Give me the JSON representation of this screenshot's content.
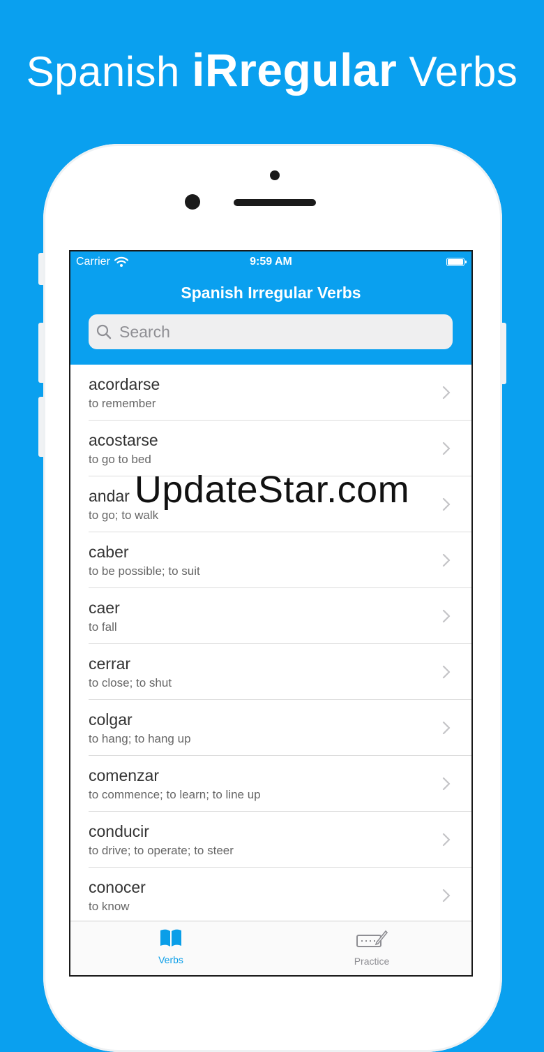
{
  "headline": {
    "part1": "Spanish ",
    "part2": "iRregular",
    "part3": " Verbs"
  },
  "status_bar": {
    "carrier": "Carrier",
    "time": "9:59 AM"
  },
  "nav": {
    "title": "Spanish Irregular Verbs"
  },
  "search": {
    "placeholder": "Search"
  },
  "verbs": [
    {
      "verb": "acordarse",
      "meaning": "to remember"
    },
    {
      "verb": "acostarse",
      "meaning": "to go to bed"
    },
    {
      "verb": "andar",
      "meaning": "to go; to walk"
    },
    {
      "verb": "caber",
      "meaning": "to be possible; to suit"
    },
    {
      "verb": "caer",
      "meaning": "to fall"
    },
    {
      "verb": "cerrar",
      "meaning": "to close; to shut"
    },
    {
      "verb": "colgar",
      "meaning": "to hang; to hang up"
    },
    {
      "verb": "comenzar",
      "meaning": "to commence; to learn; to line up"
    },
    {
      "verb": "conducir",
      "meaning": "to drive; to operate; to steer"
    },
    {
      "verb": "conocer",
      "meaning": "to know"
    }
  ],
  "tabs": [
    {
      "label": "Verbs",
      "icon": "book-icon",
      "active": true
    },
    {
      "label": "Practice",
      "icon": "keyboard-pen-icon",
      "active": false
    }
  ],
  "watermark": "UpdateStar.com",
  "colors": {
    "accent": "#0aa0ef",
    "tab_active": "#0a9ee8",
    "tab_inactive": "#8e8e93"
  }
}
